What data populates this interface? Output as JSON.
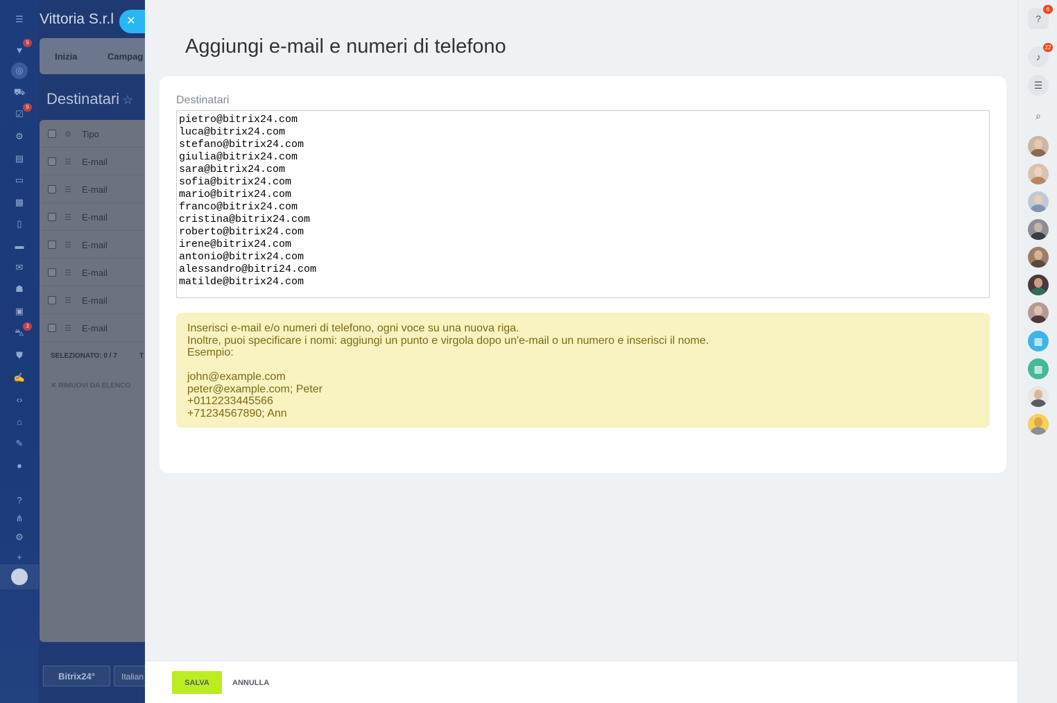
{
  "background": {
    "company_name": "Vittoria S.r.l",
    "tabs": [
      "Inizia",
      "Campag"
    ],
    "page_title": "Destinatari",
    "table_header": "Tipo",
    "rows": [
      "E-mail",
      "E-mail",
      "E-mail",
      "E-mail",
      "E-mail",
      "E-mail",
      "E-mail"
    ],
    "selected_label": "SELEZIONATO:",
    "selected_value": "0 / 7",
    "selected_trailing": "T",
    "remove_label": "RIMUOVI DA ELENCO",
    "footer_logo": "Bitrix24",
    "footer_language": "Italian"
  },
  "leftnav": {
    "badges": {
      "filter": "9",
      "tasks": "9",
      "car": "3"
    }
  },
  "slider": {
    "title": "Aggiungi e-mail e numeri di telefono",
    "recipients_label": "Destinatari",
    "recipients_value": "pietro@bitrix24.com\nluca@bitrix24.com\nstefano@bitrix24.com\ngiulia@bitrix24.com\nsara@bitrix24.com\nsofia@bitrix24.com\nmario@bitrix24.com\nfranco@bitrix24.com\ncristina@bitrix24.com\nroberto@bitrix24.com\nirene@bitrix24.com\nantonio@bitrix24.com\nalessandro@bitri24.com\nmatilde@bitrix24.com",
    "hint_lines": [
      "Inserisci e-mail e/o numeri di telefono, ogni voce su una nuova riga.",
      "Inoltre, puoi specificare i nomi: aggiungi un punto e virgola dopo un'e-mail o un numero e inserisci il nome.",
      "Esempio:"
    ],
    "hint_examples": [
      "john@example.com",
      "peter@example.com; Peter",
      "+0112233445566",
      "+71234567890; Ann"
    ],
    "save_label": "SALVA",
    "cancel_label": "ANNULLA"
  },
  "rightbar": {
    "help_badge": "6",
    "notifications_badge": "22"
  },
  "colors": {
    "accent_save": "#bbed21",
    "close_button": "#29b6f6",
    "hint_background": "#f8f3c0",
    "hint_text": "#7d6a16",
    "badge": "#f54819"
  }
}
